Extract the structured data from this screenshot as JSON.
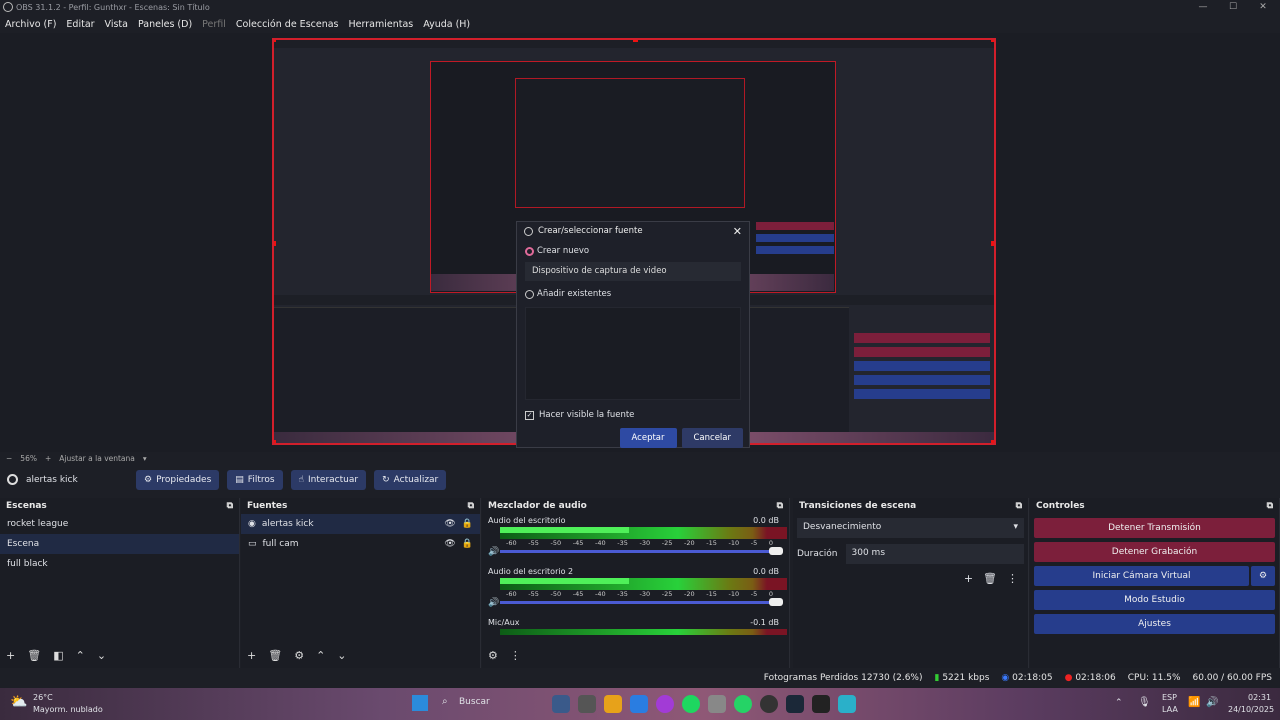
{
  "window": {
    "title": "OBS 31.1.2 - Perfil: Gunthxr - Escenas: Sin Título"
  },
  "menu": [
    "Archivo (F)",
    "Editar",
    "Vista",
    "Paneles (D)",
    "Perfil",
    "Colección de Escenas",
    "Herramientas",
    "Ayuda (H)"
  ],
  "zoom": {
    "minus": "−",
    "value": "56%",
    "plus": "+",
    "fit": "Ajustar a la ventana"
  },
  "source_toolbar": {
    "current_source": "alertas kick",
    "buttons": [
      "Propiedades",
      "Filtros",
      "Interactuar",
      "Actualizar"
    ]
  },
  "dialog": {
    "title": "Crear/seleccionar fuente",
    "opt_new": "Crear nuevo",
    "name_value": "Dispositivo de captura de video",
    "opt_existing": "Añadir existentes",
    "visible_label": "Hacer visible la fuente",
    "ok": "Aceptar",
    "cancel": "Cancelar"
  },
  "scenes": {
    "title": "Escenas",
    "items": [
      "rocket league",
      "Escena",
      "full black"
    ],
    "selected": 1
  },
  "sources": {
    "title": "Fuentes",
    "items": [
      "alertas kick",
      "full cam"
    ]
  },
  "mixer": {
    "title": "Mezclador de audio",
    "channels": [
      {
        "name": "Audio del escritorio",
        "db": "0.0 dB"
      },
      {
        "name": "Audio del escritorio 2",
        "db": "0.0 dB"
      },
      {
        "name": "Mic/Aux",
        "db": "-0.1 dB"
      }
    ],
    "scale": [
      "-60",
      "-55",
      "-50",
      "-45",
      "-40",
      "-35",
      "-30",
      "-25",
      "-20",
      "-15",
      "-10",
      "-5",
      "0"
    ]
  },
  "transitions": {
    "title": "Transiciones de escena",
    "type": "Desvanecimiento",
    "duration_label": "Duración",
    "duration_value": "300 ms"
  },
  "controls": {
    "title": "Controles",
    "stop_stream": "Detener Transmisión",
    "stop_record": "Detener Grabación",
    "virtual_cam": "Iniciar Cámara Virtual",
    "studio": "Modo Estudio",
    "settings": "Ajustes"
  },
  "status": {
    "dropped": "Fotogramas Perdidos 12730 (2.6%)",
    "bitrate": "5221 kbps",
    "stream_time": "02:18:05",
    "rec_time": "02:18:06",
    "cpu": "CPU: 11.5%",
    "fps": "60.00 / 60.00 FPS"
  },
  "taskbar": {
    "temp": "26°C",
    "weather": "Mayorm. nublado",
    "search": "Buscar",
    "lang1": "ESP",
    "lang2": "LAA",
    "time": "02:31",
    "date": "24/10/2025"
  },
  "colors": {
    "accent_red": "#7c1f3b",
    "accent_blue": "#263d8c",
    "selection_red": "#d21f2b"
  }
}
